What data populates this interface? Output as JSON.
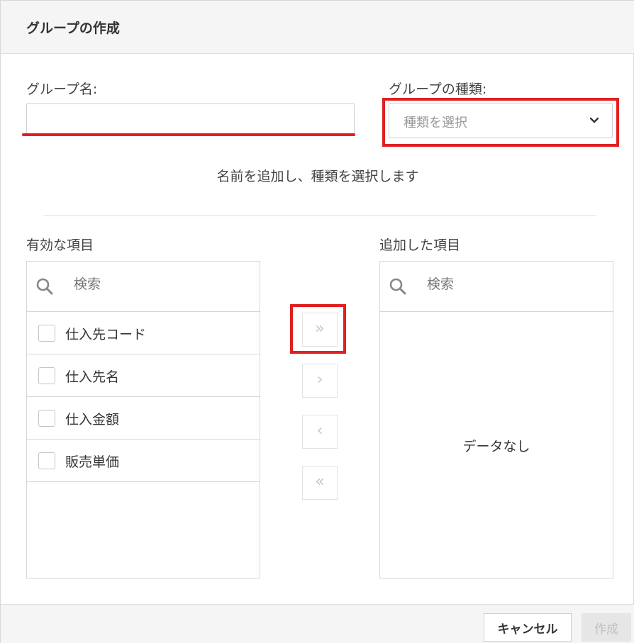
{
  "dialog": {
    "title": "グループの作成"
  },
  "form": {
    "group_name_label": "グループ名:",
    "group_name_value": "",
    "group_type_label": "グループの種類:",
    "group_type_placeholder": "種類を選択",
    "hint": "名前を追加し、種類を選択します"
  },
  "available": {
    "title": "有効な項目",
    "search_placeholder": "検索",
    "items": [
      {
        "label": "仕入先コード",
        "checked": false
      },
      {
        "label": "仕入先名",
        "checked": false
      },
      {
        "label": "仕入金額",
        "checked": false
      },
      {
        "label": "販売単価",
        "checked": false
      }
    ]
  },
  "added": {
    "title": "追加した項目",
    "search_placeholder": "検索",
    "empty_text": "データなし"
  },
  "transfer": {
    "add_all": "»",
    "add_one": "›",
    "remove_one": "‹",
    "remove_all": "«"
  },
  "footer": {
    "cancel_label": "キャンセル",
    "create_label": "作成"
  },
  "colors": {
    "highlight": "#e02020",
    "disabled_text": "#c0c0c0"
  }
}
